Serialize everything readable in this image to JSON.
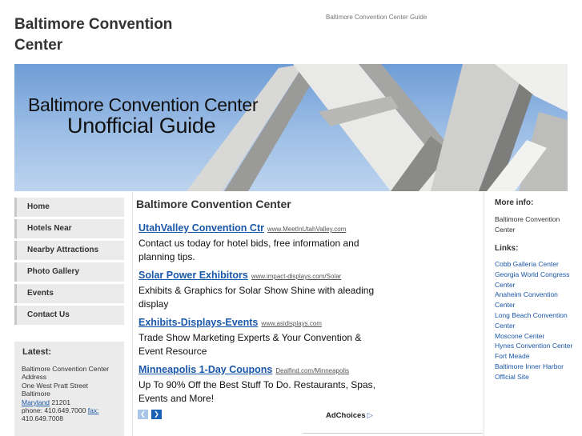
{
  "header": {
    "site_title": "Baltimore Convention Center",
    "tagline": "Baltimore Convention Center Guide"
  },
  "banner": {
    "line1": "Baltimore Convention Center",
    "line2": "Unofficial Guide"
  },
  "nav": {
    "items": [
      {
        "label": "Home"
      },
      {
        "label": "Hotels Near"
      },
      {
        "label": "Nearby Attractions"
      },
      {
        "label": "Photo Gallery"
      },
      {
        "label": "Events"
      },
      {
        "label": "Contact Us"
      }
    ]
  },
  "latest": {
    "title": "Latest:",
    "line1": "Baltimore Convention Center Address",
    "line2": "One West Pratt Street",
    "line3": "Baltimore",
    "state_link": "Maryland",
    "zip": " 21201",
    "phone": "phone: 410.649.7000",
    "fax_link": "fax:",
    "fax": " 410.649.7008"
  },
  "main": {
    "title": "Baltimore Convention Center",
    "ads": [
      {
        "title": "UtahValley Convention Ctr",
        "url": "www.MeetInUtahValley.com",
        "desc": "Contact us today for hotel bids, free information and planning tips."
      },
      {
        "title": "Solar Power Exhibitors",
        "url": "www.impact-displays.com/Solar",
        "desc": "Exhibits & Graphics for Solar Show Shine with aleading display"
      },
      {
        "title": "Exhibits-Displays-Events",
        "url": "www.asidisplays.com",
        "desc": "Trade Show Marketing Experts & Your Convention & Event Resource"
      },
      {
        "title": "Minneapolis 1-Day Coupons",
        "url": "Dealfind.com/Minneapolis",
        "desc": "Up To 90% Off the Best Stuff To Do. Restaurants, Spas, Events and More!"
      }
    ],
    "adchoices": "AdChoices"
  },
  "sidebar": {
    "more_info_title": "More info:",
    "more_info_text": "Baltimore Convention Center",
    "links_title": "Links:",
    "links": [
      "Cobb Galleria Center",
      "Georgia World Congress Center",
      "Anaheim Convention Center",
      "Long Beach Convention Center",
      "Moscone Center",
      "Hynes Convention Center",
      "Fort Meade",
      "Baltimore Inner Harbor",
      "Official Site"
    ]
  },
  "colors": {
    "link": "#1a57a8",
    "nav_bg": "#ebebeb",
    "sky": "#8fb3e0"
  }
}
